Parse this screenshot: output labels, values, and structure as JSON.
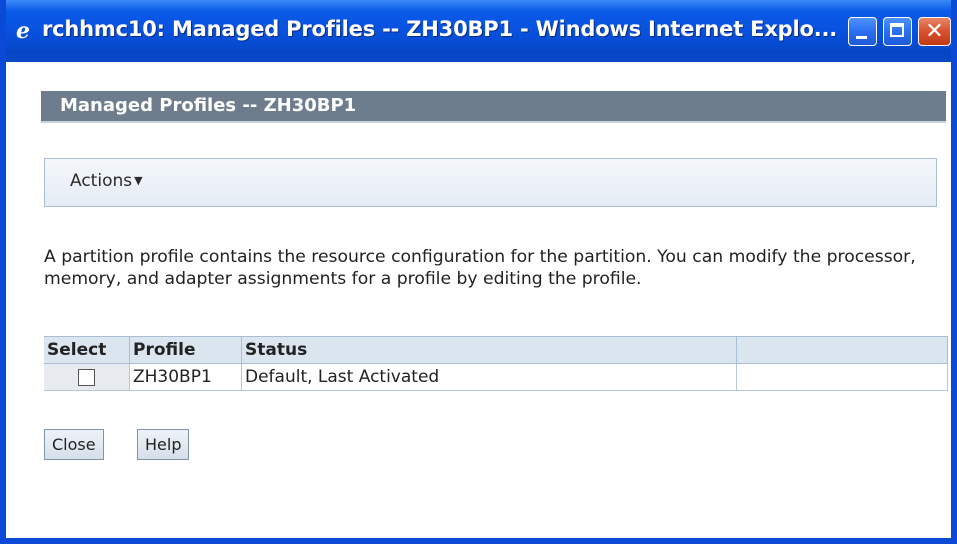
{
  "window": {
    "title": "rchhmc10: Managed Profiles -- ZH30BP1 - Windows Internet Explo...",
    "icon": "internet-explorer-icon",
    "controls": [
      "minimize-icon",
      "maximize-icon",
      "close-icon"
    ]
  },
  "page": {
    "heading": "Managed Profiles -- ZH30BP1",
    "actions_label": "Actions",
    "actions_caret": "▼",
    "description": "A partition profile contains the resource configuration for the partition. You can modify the processor, memory, and adapter assignments for a profile by editing the profile."
  },
  "table": {
    "columns": [
      "Select",
      "Profile",
      "Status",
      ""
    ],
    "rows": [
      {
        "selected": false,
        "profile": "ZH30BP1",
        "status": "Default, Last Activated"
      }
    ]
  },
  "buttons": {
    "close": "Close",
    "help": "Help"
  },
  "colors": {
    "titlebar": "#0750dc",
    "header_bar": "#6e7d8e",
    "close_button": "#d8502d"
  }
}
